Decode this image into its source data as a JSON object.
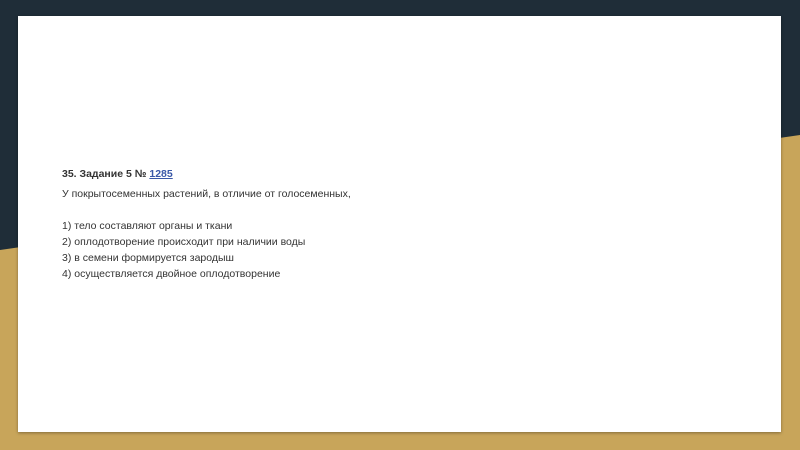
{
  "task": {
    "heading_prefix": "35. Задание 5 № ",
    "number_link": "1285",
    "question": "У покрытосеменных растений, в отличие от голосеменных,",
    "options": [
      "1) тело составляют органы и ткани",
      "2) оплодотворение происходит при наличии воды",
      "3) в семени формируется зародыш",
      "4) осуществляется двойное оплодотворение"
    ]
  },
  "colors": {
    "background_dark": "#1f2d38",
    "background_accent": "#c8a55a",
    "link": "#3a58a8",
    "text": "#333333"
  }
}
